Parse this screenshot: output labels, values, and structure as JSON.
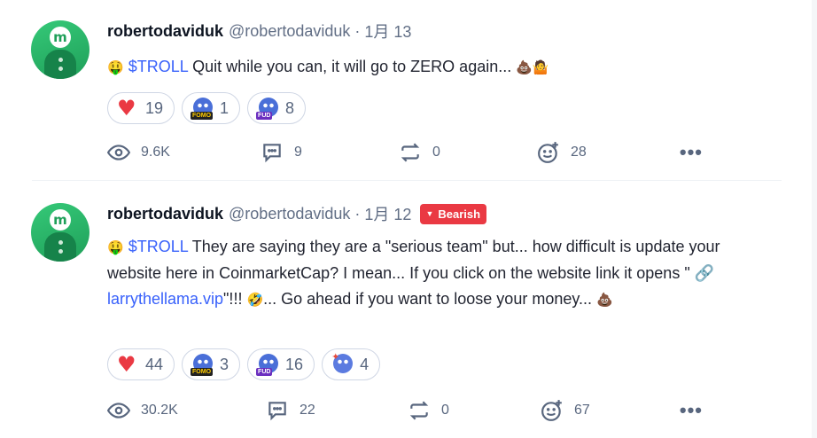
{
  "posts": [
    {
      "username": "robertodaviduk",
      "handle": "@robertodaviduk",
      "sep": "·",
      "date": "1月 13",
      "badge": "",
      "segments": {
        "emoji_prefix": "🤑",
        "ticker": "$TROLL",
        "text1": " Quit while you can, it will go to ZERO again... ",
        "emoji_suffix": "💩🤷"
      },
      "reactions": [
        {
          "icon": "heart-icon",
          "count": "19"
        },
        {
          "icon": "fomo-icon",
          "count": "1"
        },
        {
          "icon": "fud-icon",
          "count": "8"
        }
      ],
      "stats": {
        "views": "9.6K",
        "comments": "9",
        "reposts": "0",
        "likes": "28"
      },
      "more": "•••"
    },
    {
      "username": "robertodaviduk",
      "handle": "@robertodaviduk",
      "sep": "·",
      "date": "1月 12",
      "badge": "Bearish",
      "segments": {
        "emoji_prefix": "🤑",
        "ticker": "$TROLL",
        "text1": " They are saying they are a \"serious team\" but... how difficult is update your website here in CoinmarketCap? I mean... If you click on the website link it opens \" ",
        "link": "larrythellama.vip",
        "text2": "\"!!! ",
        "emoji_mid": "🤣",
        "text3": "... Go ahead if you want to loose your money... ",
        "emoji_suffix": "💩"
      },
      "reactions": [
        {
          "icon": "heart-icon",
          "count": "44"
        },
        {
          "icon": "fomo-icon",
          "count": "3"
        },
        {
          "icon": "fud-icon",
          "count": "16"
        },
        {
          "icon": "rocket-icon",
          "count": "4"
        }
      ],
      "stats": {
        "views": "30.2K",
        "comments": "22",
        "reposts": "0",
        "likes": "67"
      },
      "more": "•••"
    }
  ],
  "colors": {
    "accent": "#3861fb",
    "bearish": "#ea3943",
    "muted": "#616e85"
  }
}
